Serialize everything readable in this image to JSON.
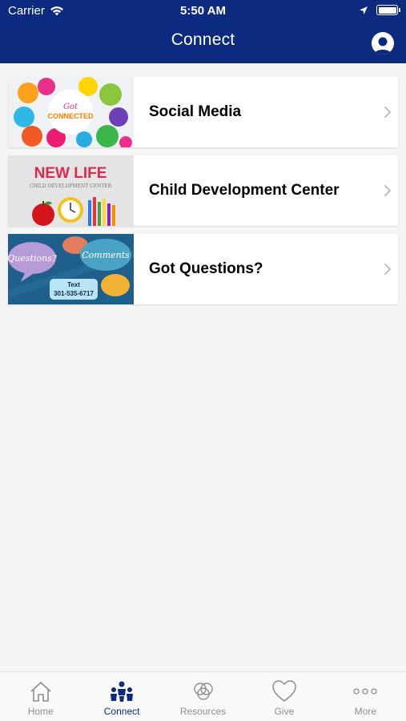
{
  "status_bar": {
    "carrier": "Carrier",
    "time": "5:50 AM"
  },
  "nav": {
    "title": "Connect"
  },
  "items": [
    {
      "label": "Social Media",
      "thumb_texts": [
        "Got",
        "CONNECTED"
      ]
    },
    {
      "label": "Child Development Center",
      "thumb_texts": [
        "NEW LIFE",
        "CHILD DEVELOPMENT CENTER"
      ]
    },
    {
      "label": "Got Questions?",
      "thumb_texts": [
        "Questions?",
        "Comments",
        "Text",
        "301-535-6717"
      ]
    }
  ],
  "tabs": [
    {
      "label": "Home",
      "icon": "home-icon",
      "active": false
    },
    {
      "label": "Connect",
      "icon": "people-icon",
      "active": true
    },
    {
      "label": "Resources",
      "icon": "circles-icon",
      "active": false
    },
    {
      "label": "Give",
      "icon": "heart-icon",
      "active": false
    },
    {
      "label": "More",
      "icon": "more-icon",
      "active": false
    }
  ],
  "colors": {
    "brand": "#0b2a80",
    "inactive": "#8e8e8e",
    "background": "#f5f5f5"
  }
}
